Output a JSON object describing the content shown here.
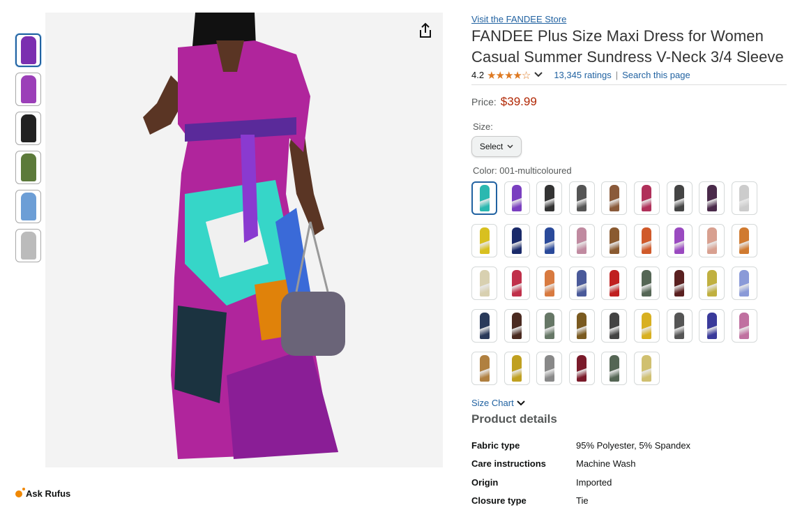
{
  "thumbnails": [
    {
      "name": "thumb-1",
      "color": "#7b2fb0"
    },
    {
      "name": "thumb-2",
      "color": "#9b3fb8"
    },
    {
      "name": "thumb-3",
      "color": "#222222"
    },
    {
      "name": "thumb-4",
      "color": "#5c7a3a"
    },
    {
      "name": "thumb-5",
      "color": "#6c9ed6"
    },
    {
      "name": "thumb-6",
      "color": "#bbbbbb"
    }
  ],
  "store_link": "Visit the FANDEE Store",
  "title": "FANDEE Plus Size Maxi Dress for Women Casual Summer Sundress V-Neck 3/4 Sleeve",
  "rating": {
    "value": "4.2",
    "stars": "★★★★☆",
    "count": "13,345 ratings",
    "search": "Search this page",
    "separator": "|"
  },
  "price": {
    "label": "Price:",
    "value": "$39.99"
  },
  "size": {
    "label": "Size:",
    "select": "Select"
  },
  "color": {
    "label": "Color: 001-multicoloured"
  },
  "swatches": [
    "#2bb8b0",
    "#7a3fc0",
    "#333333",
    "#555555",
    "#8a5a3a",
    "#b0305a",
    "#444444",
    "#4a2a4a",
    "#cccccc",
    "#d8c020",
    "#1a2a6a",
    "#2a4a9a",
    "#c08aa0",
    "#8a5a30",
    "#d05a2a",
    "#9a4ac0",
    "#d8a090",
    "#d07a30",
    "#d8d0b0",
    "#c0304a",
    "#d87a40",
    "#4a5a9a",
    "#c02020",
    "#556655",
    "#5a2020",
    "#c0b040",
    "#8a9ad8",
    "#2a3a5a",
    "#4a2a20",
    "#667766",
    "#7a5a20",
    "#444444",
    "#d8b020",
    "#555555",
    "#3a3a9a",
    "#c070a0",
    "#b08040",
    "#c0a020",
    "#888888",
    "#7a1a2a",
    "#556655",
    "#d0c070"
  ],
  "size_chart": "Size Chart",
  "product_details": {
    "heading": "Product details",
    "rows": [
      {
        "k": "Fabric type",
        "v": "95% Polyester, 5% Spandex"
      },
      {
        "k": "Care instructions",
        "v": "Machine Wash"
      },
      {
        "k": "Origin",
        "v": "Imported"
      },
      {
        "k": "Closure type",
        "v": "Tie"
      }
    ]
  },
  "rufus": "Ask Rufus"
}
